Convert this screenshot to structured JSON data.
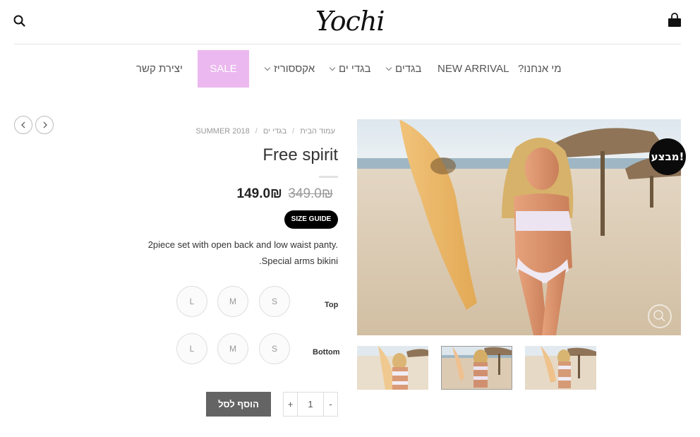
{
  "header": {
    "logo_text": "Yochi",
    "search_icon": "search-icon",
    "cart_icon": "shopping-bag-icon"
  },
  "nav": {
    "items": [
      {
        "label": "מי אנחנו?"
      },
      {
        "label": "NEW ARRIVAL"
      },
      {
        "label": "בגדים",
        "has_dropdown": true
      },
      {
        "label": "בגדי ים",
        "has_dropdown": true
      },
      {
        "label": "אקססוריז",
        "has_dropdown": true
      },
      {
        "label": "SALE",
        "highlight_color": "#ebb8ef"
      },
      {
        "label": "יצירת קשר"
      }
    ]
  },
  "gallery": {
    "badge": "מבצע!",
    "thumbnails": 3,
    "active_thumbnail": 2
  },
  "product": {
    "breadcrumb": [
      "עמוד הבית",
      "בגדי ים",
      "SUMMER 2018"
    ],
    "title": "Free spirit",
    "price": "149.0₪",
    "old_price": "349.0₪",
    "size_guide_label": "SIZE GUIDE",
    "description_lines": [
      "2piece set with open back and low waist panty.",
      "Special arms bikini."
    ],
    "options": [
      {
        "label": "Top",
        "sizes": [
          "S",
          "M",
          "L"
        ]
      },
      {
        "label": "Bottom",
        "sizes": [
          "S",
          "M",
          "L"
        ]
      }
    ],
    "quantity": "1",
    "qty_plus": "+",
    "qty_minus": "-",
    "add_to_cart_label": "הוסף לסל"
  },
  "colors": {
    "sale_bg": "#ebb8ef",
    "add_to_cart_bg": "#646464",
    "badge_bg": "#0b0b0b"
  }
}
